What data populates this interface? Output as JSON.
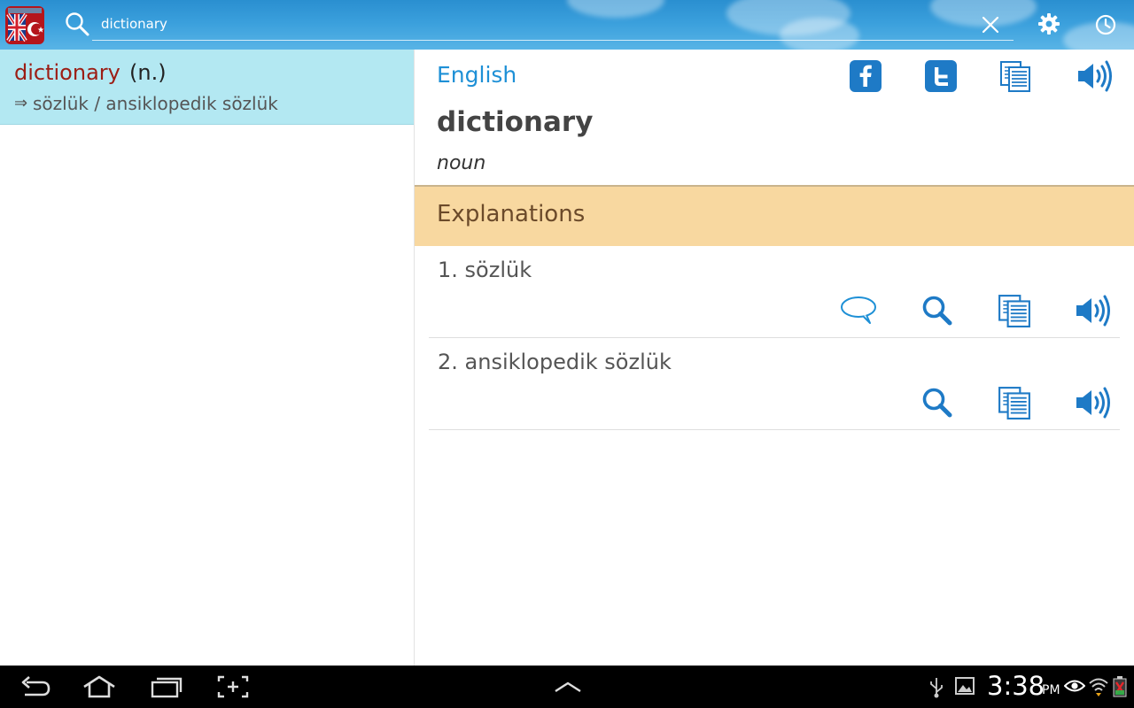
{
  "search": {
    "value": "dictionary"
  },
  "results": [
    {
      "word": "dictionary",
      "pos": "(n.)",
      "arrow": "⇒",
      "translation": "sözlük / ansiklopedik sözlük"
    }
  ],
  "detail": {
    "language": "English",
    "word": "dictionary",
    "pos": "noun",
    "header_icons": [
      "facebook-icon",
      "twitter-icon",
      "copy-icon",
      "speaker-icon"
    ],
    "section_title": "Explanations",
    "senses": [
      {
        "text": "1. sözlük",
        "icons": [
          "comment-icon",
          "search-icon",
          "copy-icon",
          "speaker-icon"
        ]
      },
      {
        "text": "2. ansiklopedik sözlük",
        "icons": [
          "search-icon",
          "copy-icon",
          "speaker-icon"
        ]
      }
    ]
  },
  "statusbar": {
    "time": "3:38",
    "ampm": "PM"
  },
  "colors": {
    "accent": "#1e90d6",
    "selected_row": "#b3e8f2",
    "section_bar": "#f8d8a0",
    "headword_red": "#9c1d14"
  }
}
